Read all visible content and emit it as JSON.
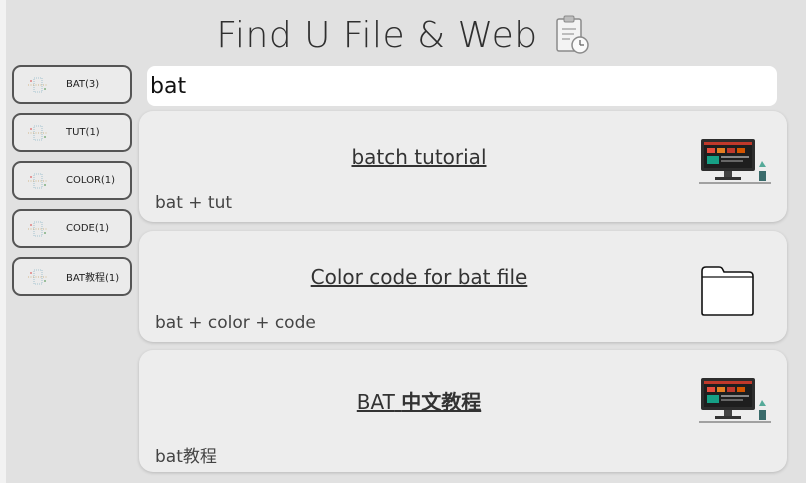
{
  "app": {
    "title": "Find U File & Web",
    "title_icon": "clipboard-clock-icon"
  },
  "search": {
    "value": "bat"
  },
  "sidebar": {
    "tags": [
      {
        "label": "BAT(3)"
      },
      {
        "label": "TUT(1)"
      },
      {
        "label": "COLOR(1)"
      },
      {
        "label": "CODE(1)"
      },
      {
        "label": "BAT教程(1)"
      }
    ]
  },
  "results": [
    {
      "title": "batch tutorial",
      "keywords": "bat + tut",
      "thumb": "website-monitor-icon"
    },
    {
      "title": "Color code for bat file",
      "keywords": "bat + color + code",
      "thumb": "folder-icon"
    },
    {
      "title_prefix": "BAT",
      "title_bold": "中文教程",
      "keywords": "bat教程",
      "thumb": "website-monitor-icon"
    }
  ],
  "colors": {
    "background": "#e1e1e1",
    "card": "#ededed",
    "border": "#555555",
    "search_bg": "#ffffff"
  }
}
